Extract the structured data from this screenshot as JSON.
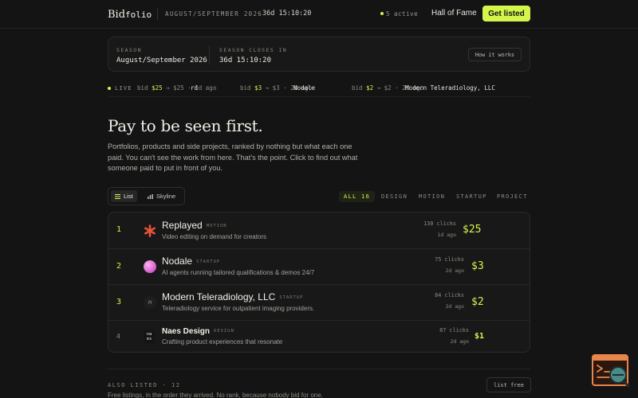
{
  "nav": {
    "logo_a": "Bid",
    "logo_b": "folio",
    "season": "AUGUST/SEPTEMBER 2026",
    "timer": "36d 15:10:20",
    "active": "5 active",
    "hall_of_fame": "Hall of Fame",
    "cta": "Get listed"
  },
  "season_card": {
    "season_label": "SEASON",
    "season_value": "August/September 2026",
    "closes_label": "SEASON CLOSES IN",
    "closes_value": "36d 15:10:20",
    "how_button": "How it works"
  },
  "ticker": {
    "live": "LIVE",
    "items": [
      {
        "name": "rd",
        "bid_word": "bid",
        "amount": "$25",
        "rest": "→ $25 · 1d ago"
      },
      {
        "name": "Nodale",
        "bid_word": "bid",
        "amount": "$3",
        "rest": "→ $3 · 2d ago"
      },
      {
        "name": "Modern Teleradiology, LLC",
        "bid_word": "bid",
        "amount": "$2",
        "rest": "→ $2 · 2d ago"
      }
    ]
  },
  "hero": {
    "title": "Pay to be seen first.",
    "body": "Portfolios, products and side projects, ranked by nothing but what each one paid. You can't see the work from here. That's the point. Click to find out what someone paid to put in front of you."
  },
  "view_toggle": {
    "list": "List",
    "skyline": "Skyline"
  },
  "filters": [
    "ALL 16",
    "DESIGN",
    "MOTION",
    "STARTUP",
    "PROJECT"
  ],
  "ranking": [
    {
      "rank": "1",
      "name": "Replayed",
      "category": "MOTION",
      "description": "Video editing on demand for creators",
      "clicks": "130 clicks",
      "ago": "1d ago",
      "bid": "$25",
      "avatar_icon": "asterisk-icon",
      "avatar_text": "",
      "avatar_color": "#e8543a"
    },
    {
      "rank": "2",
      "name": "Nodale",
      "category": "STARTUP",
      "description": "AI agents running tailored qualifications & demos 24/7",
      "clicks": "75 clicks",
      "ago": "2d ago",
      "bid": "$3",
      "avatar_icon": "orb-icon",
      "avatar_text": "",
      "avatar_color": "#e07ad8"
    },
    {
      "rank": "3",
      "name": "Modern Teleradiology, LLC",
      "category": "STARTUP",
      "description": "Teleradiology service for outpatient imaging providers.",
      "clicks": "84 clicks",
      "ago": "2d ago",
      "bid": "$2",
      "avatar_icon": "monogram-icon",
      "avatar_text": "M",
      "avatar_color": "#1e1e1e"
    },
    {
      "rank": "4",
      "name": "Naes Design",
      "category": "DESIGN",
      "description": "Crafting product experiences that resonate",
      "clicks": "87 clicks",
      "ago": "2d ago",
      "bid": "$1",
      "avatar_icon": "naes-logo-icon",
      "avatar_text": "na es",
      "avatar_color": "#141414"
    }
  ],
  "also_listed": {
    "label": "ALSO LISTED · 12",
    "body": "Free listings, in the order they arrived. No rank, because nobody bid for one.",
    "list_free": "list free"
  },
  "colors": {
    "accent": "#d4f54a",
    "background": "#141414",
    "card": "#181818"
  }
}
